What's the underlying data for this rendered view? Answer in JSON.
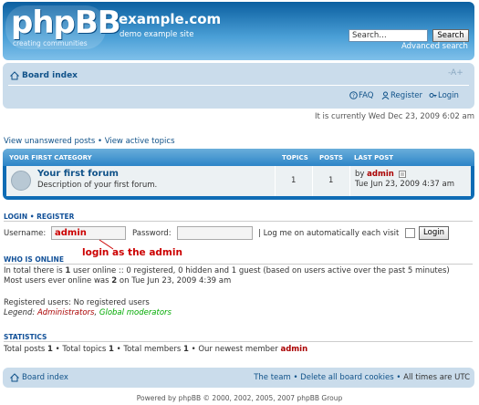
{
  "header": {
    "logo": "phpBB",
    "logo_tagline": "creating communities",
    "site_title": "example.com",
    "site_description": "demo example site",
    "search_placeholder": "Search…",
    "search_button": "Search",
    "advanced_search": "Advanced search"
  },
  "nav": {
    "board_index": "Board index",
    "font_size": "-A+",
    "faq": "FAQ",
    "register": "Register",
    "login": "Login"
  },
  "current_time": "It is currently Wed Dec 23, 2009 6:02 am",
  "view_links": {
    "unanswered": "View unanswered posts",
    "separator": " • ",
    "active": "View active topics"
  },
  "forum_table": {
    "category": "YOUR FIRST CATEGORY",
    "columns": [
      "TOPICS",
      "POSTS",
      "LAST POST"
    ],
    "forum": {
      "name": "Your first forum",
      "description": "Description of your first forum.",
      "topics": "1",
      "posts": "1",
      "last_post_by_prefix": "by ",
      "last_post_user": "admin",
      "last_post_date": "Tue Jun 23, 2009 4:37 am"
    }
  },
  "login_section": {
    "heading_login": "LOGIN",
    "heading_sep": " • ",
    "heading_register": "REGISTER",
    "username_label": "Username:",
    "username_value": "admin",
    "password_label": "Password:",
    "autologin_label": "| Log me on automatically each visit",
    "login_button": "Login",
    "annotation": "login as the admin"
  },
  "who_is_online": {
    "heading": "WHO IS ONLINE",
    "line1_a": "In total there is ",
    "line1_count": "1",
    "line1_b": " user online :: 0 registered, 0 hidden and 1 guest (based on users active over the past 5 minutes)",
    "line2_a": "Most users ever online was ",
    "line2_count": "2",
    "line2_b": " on Tue Jun 23, 2009 4:39 am",
    "registered": "Registered users: No registered users",
    "legend_label": "Legend: ",
    "legend_admins": "Administrators",
    "legend_sep": ", ",
    "legend_mods": "Global moderators"
  },
  "statistics": {
    "heading": "STATISTICS",
    "posts_label": "Total posts ",
    "posts": "1",
    "topics_label": " • Total topics ",
    "topics": "1",
    "members_label": " • Total members ",
    "members": "1",
    "newest_label": " • Our newest member ",
    "newest": "admin"
  },
  "footer": {
    "board_index": "Board index",
    "team": "The team",
    "sep": " • ",
    "delete_cookies": "Delete all board cookies",
    "timezone": "All times are UTC"
  },
  "powered_by": "Powered by phpBB © 2000, 2002, 2005, 2007 phpBB Group",
  "colors": {
    "header_blue": "#0b5fa0",
    "nav_bg": "#cadceb",
    "link": "#105289",
    "admin_red": "#aa0000",
    "mod_green": "#00aa00"
  }
}
